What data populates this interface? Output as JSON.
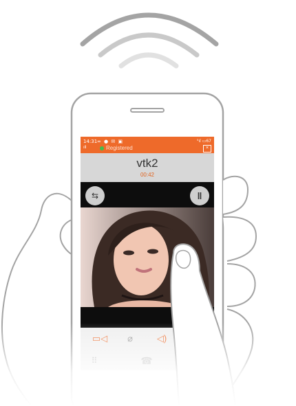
{
  "status_bar": {
    "time": "14:31",
    "left_icons": "∞ ● ✉ ▣",
    "right_icons": "⁵ıl ▭67",
    "signal": "ıll",
    "registration": "Registered"
  },
  "call": {
    "contact": "vtk2",
    "timer": "00:42"
  },
  "video": {
    "switch_icon": "camera-switch-icon",
    "pause_icon": "pause-icon"
  },
  "controls": {
    "camera_icon": "video-camera-icon",
    "mic_icon": "mic-off-icon",
    "speaker_icon": "speaker-icon",
    "dialpad_icon": "dialpad-icon",
    "hangup_icon": "phone-icon"
  },
  "colors": {
    "accent": "#ee6a2a",
    "outline": "#a3a3a3",
    "wifi_dark": "#a4a4a4",
    "wifi_mid": "#c9c9c9",
    "wifi_light": "#e1e1e1"
  }
}
